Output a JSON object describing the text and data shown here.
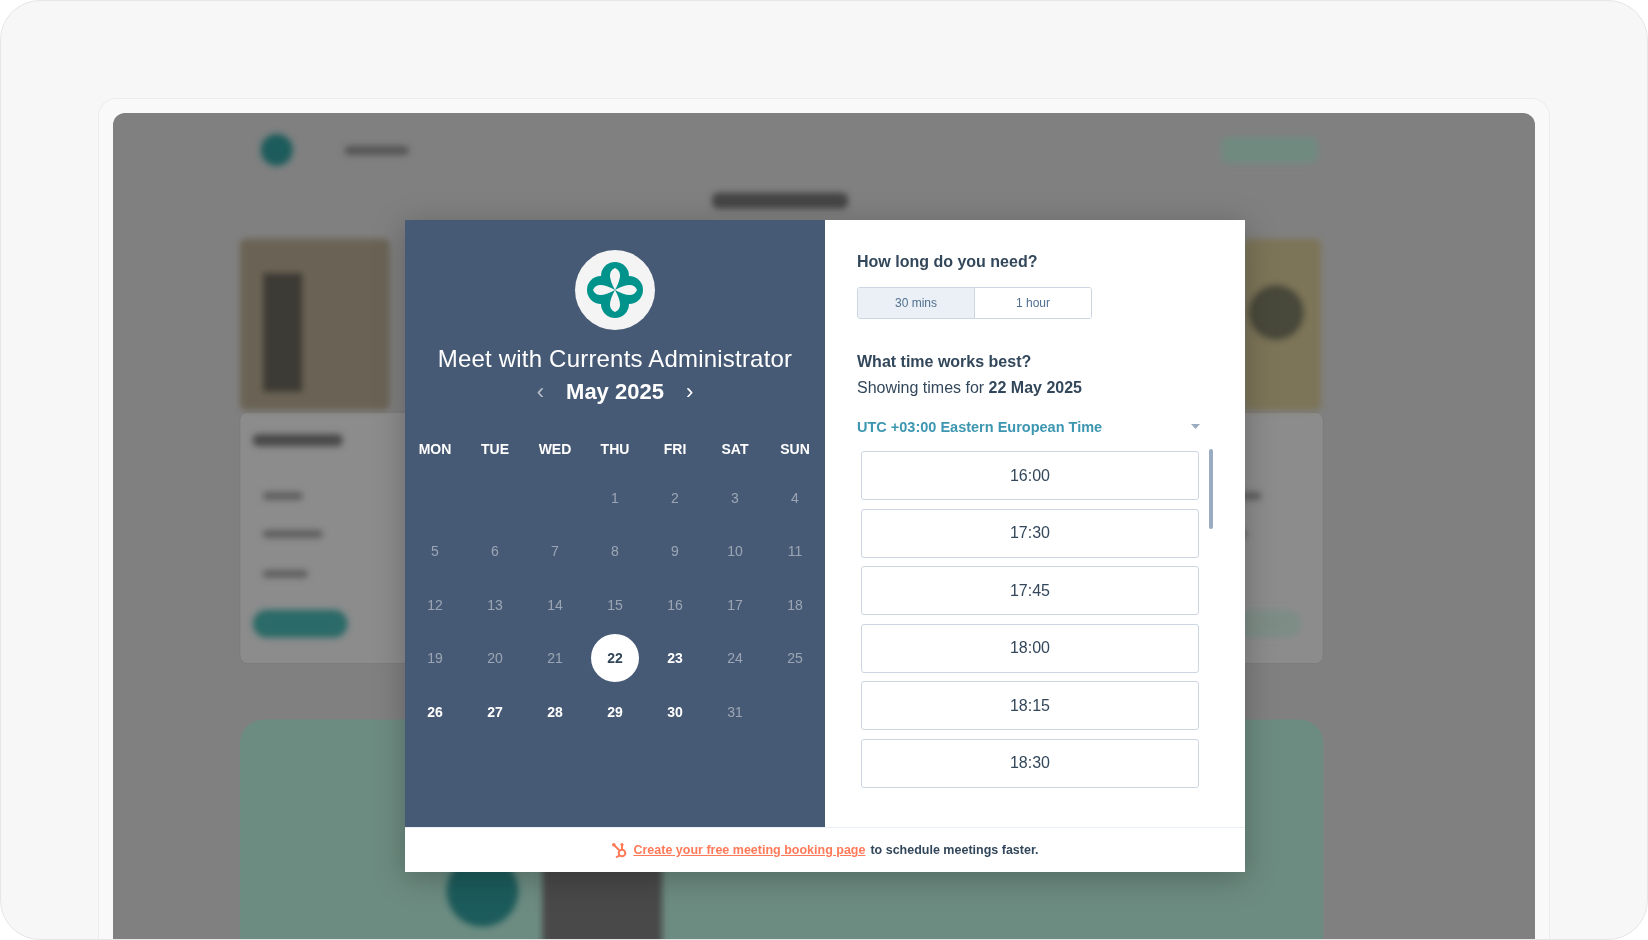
{
  "calendar": {
    "title": "Meet with Currents Administrator",
    "month": "May 2025",
    "prev": "‹",
    "next": "›",
    "weekdays": [
      "MON",
      "TUE",
      "WED",
      "THU",
      "FRI",
      "SAT",
      "SUN"
    ],
    "weeks": [
      [
        {
          "label": "1",
          "available": false,
          "selected": false
        },
        {
          "label": "2",
          "available": false,
          "selected": false
        },
        {
          "label": "3",
          "available": false,
          "selected": false
        },
        {
          "label": "4",
          "available": false,
          "selected": false
        }
      ],
      [
        {
          "label": "5",
          "available": false,
          "selected": false
        },
        {
          "label": "6",
          "available": false,
          "selected": false
        },
        {
          "label": "7",
          "available": false,
          "selected": false
        },
        {
          "label": "8",
          "available": false,
          "selected": false
        },
        {
          "label": "9",
          "available": false,
          "selected": false
        },
        {
          "label": "10",
          "available": false,
          "selected": false
        },
        {
          "label": "11",
          "available": false,
          "selected": false
        }
      ],
      [
        {
          "label": "12",
          "available": false,
          "selected": false
        },
        {
          "label": "13",
          "available": false,
          "selected": false
        },
        {
          "label": "14",
          "available": false,
          "selected": false
        },
        {
          "label": "15",
          "available": false,
          "selected": false
        },
        {
          "label": "16",
          "available": false,
          "selected": false
        },
        {
          "label": "17",
          "available": false,
          "selected": false
        },
        {
          "label": "18",
          "available": false,
          "selected": false
        }
      ],
      [
        {
          "label": "19",
          "available": false,
          "selected": false
        },
        {
          "label": "20",
          "available": false,
          "selected": false
        },
        {
          "label": "21",
          "available": false,
          "selected": false
        },
        {
          "label": "22",
          "available": true,
          "selected": true
        },
        {
          "label": "23",
          "available": true,
          "selected": false
        },
        {
          "label": "24",
          "available": false,
          "selected": false
        },
        {
          "label": "25",
          "available": false,
          "selected": false
        }
      ],
      [
        {
          "label": "26",
          "available": true,
          "selected": false
        },
        {
          "label": "27",
          "available": true,
          "selected": false
        },
        {
          "label": "28",
          "available": true,
          "selected": false
        },
        {
          "label": "29",
          "available": true,
          "selected": false
        },
        {
          "label": "30",
          "available": true,
          "selected": false
        },
        {
          "label": "31",
          "available": false,
          "selected": false
        }
      ]
    ]
  },
  "booking": {
    "duration_heading": "How long do you need?",
    "durations": [
      {
        "label": "30 mins",
        "selected": true
      },
      {
        "label": "1 hour",
        "selected": false
      }
    ],
    "time_heading": "What time works best?",
    "showing": "Showing times for **22 May 2025**",
    "timezone": "UTC +03:00 Eastern European Time",
    "slots": [
      "16:00",
      "17:30",
      "17:45",
      "18:00",
      "18:15",
      "18:30"
    ]
  },
  "footer": {
    "link": "Create your free meeting booking page",
    "text": "to schedule meetings faster."
  }
}
